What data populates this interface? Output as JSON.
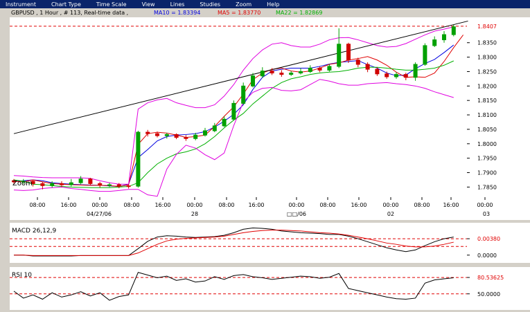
{
  "menu": [
    "Instrument",
    "Chart Type",
    "Time Scale",
    "View",
    "Lines",
    "Studies",
    "Zoom",
    "Help"
  ],
  "legend": {
    "title": "GBPUSD , 1 Hour , # 113, Real-time data ,",
    "ma10": "MA10 = 1.83394",
    "ma5": "MA5 = 1.83770",
    "ma22": "MA22 = 1.82869"
  },
  "colors": {
    "price_up": "#00a000",
    "price_down": "#d00000",
    "ma10": "#0000e0",
    "ma5": "#e00000",
    "ma22": "#00b000",
    "bollinger": "#e000e0",
    "trendline": "#000000",
    "ref_line": "#e00000",
    "legend_title": "#000000"
  },
  "zoom_label": "Zoom",
  "x_axis": {
    "time_labels": [
      "08:00",
      "16:00",
      "00:00",
      "08:00",
      "16:00",
      "00:00",
      "08:00",
      "16:00",
      "00:00",
      "08:00",
      "16:00",
      "00:00",
      "08:00",
      "16:00",
      "00:00"
    ],
    "date_labels": [
      "04/27/06",
      "28",
      "□□/06",
      "02",
      "03"
    ]
  },
  "chart_data": [
    {
      "type": "line",
      "title": "GBPUSD , 1 Hour",
      "ylim": [
        1.7815,
        1.8438
      ],
      "yticks": [
        "1.8350",
        "1.8300",
        "1.8250",
        "1.8200",
        "1.8150",
        "1.8100",
        "1.8050",
        "1.8000",
        "1.7950",
        "1.7900",
        "1.7850"
      ],
      "last_price_label": "1.8407",
      "last_price": 1.8407,
      "series": [
        {
          "name": "MA10",
          "values": [
            1.787,
            1.7872,
            1.7875,
            1.7872,
            1.7865,
            1.7862,
            1.786,
            1.7858,
            1.7857,
            1.7856,
            1.7854,
            1.7852,
            1.786,
            1.7952,
            1.798,
            1.801,
            1.8025,
            1.803,
            1.8032,
            1.8035,
            1.8042,
            1.8058,
            1.8078,
            1.8102,
            1.8135,
            1.8188,
            1.823,
            1.8252,
            1.8258,
            1.8262,
            1.8262,
            1.8262,
            1.8268,
            1.8276,
            1.8282,
            1.8285,
            1.8288,
            1.8274,
            1.8262,
            1.8245,
            1.8236,
            1.8238,
            1.826,
            1.8278,
            1.8292,
            1.8316,
            1.8342
          ]
        },
        {
          "name": "MA5",
          "values": [
            1.787,
            1.7868,
            1.7875,
            1.7868,
            1.7862,
            1.786,
            1.7858,
            1.7857,
            1.7856,
            1.7856,
            1.7855,
            1.7852,
            1.7858,
            1.7998,
            1.8035,
            1.804,
            1.8037,
            1.803,
            1.8022,
            1.8025,
            1.803,
            1.806,
            1.8095,
            1.8128,
            1.8172,
            1.8222,
            1.8245,
            1.8258,
            1.8262,
            1.8252,
            1.8248,
            1.8252,
            1.8262,
            1.8275,
            1.828,
            1.829,
            1.8295,
            1.8302,
            1.829,
            1.8272,
            1.8248,
            1.823,
            1.8232,
            1.823,
            1.8245,
            1.8285,
            1.8333,
            1.8377
          ]
        },
        {
          "name": "MA22",
          "values": [
            1.7875,
            1.787,
            1.786,
            1.7858,
            1.7855,
            1.7852,
            1.785,
            1.7849,
            1.7848,
            1.7848,
            1.7848,
            1.785,
            1.7852,
            1.7865,
            1.79,
            1.793,
            1.795,
            1.7965,
            1.7972,
            1.7982,
            1.8,
            1.8025,
            1.8055,
            1.8082,
            1.8105,
            1.8138,
            1.8165,
            1.8192,
            1.8212,
            1.8225,
            1.8232,
            1.824,
            1.8245,
            1.8248,
            1.825,
            1.8255,
            1.8262,
            1.8265,
            1.8265,
            1.8262,
            1.8258,
            1.8255,
            1.8255,
            1.8258,
            1.8262,
            1.8272,
            1.8287
          ]
        },
        {
          "name": "Bollinger Upper",
          "values": [
            1.789,
            1.7888,
            1.7885,
            1.7883,
            1.7882,
            1.7882,
            1.7882,
            1.7882,
            1.788,
            1.7872,
            1.7865,
            1.786,
            1.786,
            1.812,
            1.8142,
            1.8152,
            1.8157,
            1.8142,
            1.8133,
            1.8125,
            1.8125,
            1.8135,
            1.8165,
            1.8205,
            1.8255,
            1.8295,
            1.8325,
            1.8345,
            1.835,
            1.834,
            1.8335,
            1.8335,
            1.8345,
            1.836,
            1.8367,
            1.8368,
            1.836,
            1.835,
            1.834,
            1.8335,
            1.8337,
            1.8347,
            1.8362,
            1.8377,
            1.839,
            1.8397,
            1.8405
          ]
        },
        {
          "name": "Bollinger Lower",
          "values": [
            1.784,
            1.7838,
            1.784,
            1.7845,
            1.7848,
            1.785,
            1.7845,
            1.7842,
            1.7838,
            1.7835,
            1.7835,
            1.7838,
            1.7842,
            1.7842,
            1.7823,
            1.7818,
            1.7912,
            1.7963,
            1.7995,
            1.7985,
            1.7962,
            1.7945,
            1.7968,
            1.8063,
            1.8145,
            1.8178,
            1.8192,
            1.8195,
            1.8185,
            1.8183,
            1.8187,
            1.8205,
            1.8223,
            1.8217,
            1.8208,
            1.8203,
            1.8203,
            1.8208,
            1.821,
            1.8212,
            1.8208,
            1.8205,
            1.82,
            1.8192,
            1.818,
            1.817,
            1.816
          ]
        },
        {
          "name": "Trendline",
          "x": [
            0,
            47.5
          ],
          "values": [
            1.8035,
            1.8425
          ]
        }
      ],
      "candles": [
        [
          1.7872,
          1.7868,
          1.7878,
          1.7862
        ],
        [
          1.7868,
          1.787,
          1.7878,
          1.786
        ],
        [
          1.787,
          1.7862,
          1.7875,
          1.7852
        ],
        [
          1.7862,
          1.7855,
          1.7868,
          1.7842
        ],
        [
          1.7855,
          1.7862,
          1.787,
          1.7848
        ],
        [
          1.7862,
          1.7858,
          1.787,
          1.785
        ],
        [
          1.7858,
          1.7865,
          1.7878,
          1.7852
        ],
        [
          1.7865,
          1.7878,
          1.7888,
          1.786
        ],
        [
          1.7878,
          1.7862,
          1.7882,
          1.7855
        ],
        [
          1.7862,
          1.7856,
          1.7868,
          1.7848
        ],
        [
          1.7856,
          1.7858,
          1.7865,
          1.785
        ],
        [
          1.7858,
          1.7854,
          1.7864,
          1.7846
        ],
        [
          1.7854,
          1.7853,
          1.786,
          1.7845
        ],
        [
          1.7853,
          1.804,
          1.8045,
          1.7848
        ],
        [
          1.804,
          1.8035,
          1.8048,
          1.8025
        ],
        [
          1.8035,
          1.8028,
          1.8042,
          1.8022
        ],
        [
          1.8028,
          1.8032,
          1.8038,
          1.8018
        ],
        [
          1.8032,
          1.8022,
          1.8036,
          1.8016
        ],
        [
          1.8022,
          1.8018,
          1.803,
          1.801
        ],
        [
          1.8018,
          1.803,
          1.8038,
          1.8012
        ],
        [
          1.803,
          1.8045,
          1.8055,
          1.8025
        ],
        [
          1.8045,
          1.8062,
          1.8072,
          1.804
        ],
        [
          1.8062,
          1.8085,
          1.8095,
          1.8058
        ],
        [
          1.8085,
          1.814,
          1.815,
          1.808
        ],
        [
          1.814,
          1.82,
          1.8212,
          1.8135
        ],
        [
          1.82,
          1.8235,
          1.8245,
          1.8195
        ],
        [
          1.8235,
          1.8252,
          1.8265,
          1.8228
        ],
        [
          1.8252,
          1.8245,
          1.8262,
          1.8238
        ],
        [
          1.8245,
          1.824,
          1.8255,
          1.8232
        ],
        [
          1.824,
          1.8245,
          1.8252,
          1.8235
        ],
        [
          1.8245,
          1.825,
          1.8262,
          1.824
        ],
        [
          1.825,
          1.8262,
          1.8272,
          1.8245
        ],
        [
          1.8262,
          1.8255,
          1.8268,
          1.8248
        ],
        [
          1.8255,
          1.8268,
          1.8275,
          1.825
        ],
        [
          1.8268,
          1.8345,
          1.84,
          1.8262
        ],
        [
          1.8345,
          1.829,
          1.835,
          1.828
        ],
        [
          1.829,
          1.8275,
          1.8298,
          1.8265
        ],
        [
          1.8275,
          1.8258,
          1.8282,
          1.8248
        ],
        [
          1.8258,
          1.8242,
          1.8265,
          1.8235
        ],
        [
          1.8242,
          1.8232,
          1.825,
          1.8225
        ],
        [
          1.8232,
          1.824,
          1.8248,
          1.8225
        ],
        [
          1.824,
          1.823,
          1.8246,
          1.822
        ],
        [
          1.823,
          1.8275,
          1.8282,
          1.8218
        ],
        [
          1.8275,
          1.834,
          1.8348,
          1.827
        ],
        [
          1.834,
          1.836,
          1.8372,
          1.8335
        ],
        [
          1.836,
          1.8378,
          1.839,
          1.835
        ],
        [
          1.8378,
          1.8405,
          1.8412,
          1.8372
        ]
      ]
    },
    {
      "type": "line",
      "title": "MACD 26,12,9",
      "ylim": [
        -0.0018,
        0.0075
      ],
      "yticks": [
        "0.00380",
        "0.0000"
      ],
      "hlines": [
        0.0038,
        0.002
      ],
      "series": [
        {
          "name": "MACD",
          "values": [
            0,
            0,
            -0.0002,
            -0.0002,
            -0.0002,
            -0.0002,
            -0.0002,
            -0.0001,
            -0.0001,
            -0.0001,
            -0.0001,
            -0.0001,
            -0.0001,
            0.0015,
            0.0032,
            0.0042,
            0.0045,
            0.0044,
            0.0042,
            0.0041,
            0.0042,
            0.0043,
            0.0046,
            0.0052,
            0.006,
            0.0063,
            0.0062,
            0.006,
            0.0056,
            0.0054,
            0.0052,
            0.0051,
            0.005,
            0.0048,
            0.0048,
            0.0044,
            0.0038,
            0.0031,
            0.0024,
            0.0017,
            0.0012,
            0.0008,
            0.0012,
            0.0022,
            0.0031,
            0.0038,
            0.0042
          ]
        },
        {
          "name": "Signal",
          "values": [
            0,
            0,
            -0.0001,
            -0.0001,
            -0.0001,
            -0.0001,
            -0.0001,
            -0.0001,
            -0.0001,
            -0.0001,
            -0.0001,
            -0.0001,
            -0.0001,
            0.0005,
            0.0015,
            0.0025,
            0.0033,
            0.0037,
            0.0039,
            0.004,
            0.0041,
            0.0042,
            0.0044,
            0.0048,
            0.0052,
            0.0055,
            0.0057,
            0.0058,
            0.0058,
            0.0057,
            0.0056,
            0.0054,
            0.0052,
            0.0051,
            0.0049,
            0.0046,
            0.0042,
            0.0038,
            0.0033,
            0.0028,
            0.0025,
            0.0021,
            0.0019,
            0.0019,
            0.0021,
            0.0025,
            0.003
          ]
        }
      ]
    },
    {
      "type": "line",
      "title": "RSI 10",
      "ylim": [
        20,
        100
      ],
      "yticks": [
        "80.53625",
        "50.0000"
      ],
      "hlines": [
        80.5,
        50
      ],
      "series": [
        {
          "name": "RSI",
          "values": [
            55,
            42,
            48,
            40,
            52,
            44,
            48,
            54,
            46,
            52,
            38,
            45,
            48,
            90,
            85,
            80,
            83,
            75,
            78,
            72,
            74,
            82,
            77,
            84,
            86,
            82,
            80,
            77,
            79,
            81,
            83,
            82,
            79,
            81,
            88,
            60,
            56,
            52,
            48,
            44,
            41,
            40,
            42,
            70,
            76,
            78,
            80
          ]
        }
      ]
    }
  ]
}
